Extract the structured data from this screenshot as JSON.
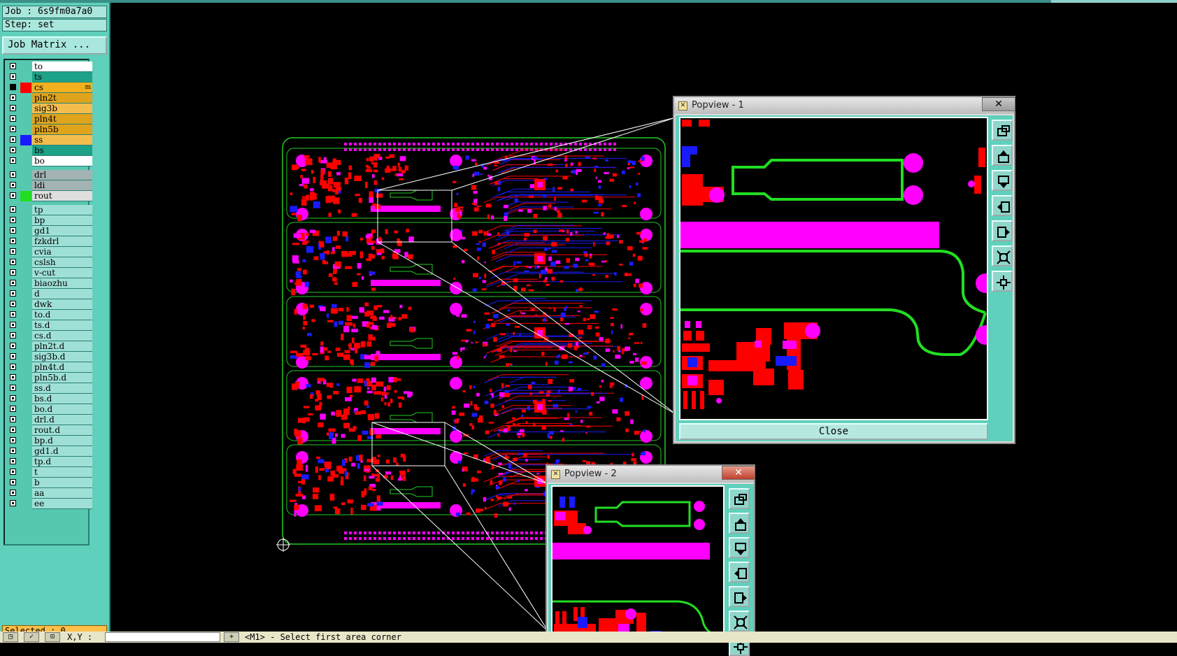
{
  "header": {
    "job_label": "Job : 6s9fm0a7a0",
    "step_label": "Step: set",
    "job_matrix_button": "Job Matrix ..."
  },
  "layers": {
    "board": [
      {
        "name": "to",
        "color": "#ffffff",
        "swatch": ""
      },
      {
        "name": "ts",
        "color": "#1ea287",
        "swatch": ""
      },
      {
        "name": "cs",
        "color": "#f2b01e",
        "swatch": "#ff0000",
        "mark": "m",
        "active": true
      },
      {
        "name": "pln2t",
        "color": "#e0a41c",
        "swatch": ""
      },
      {
        "name": "sig3b",
        "color": "#f3bd4e",
        "swatch": ""
      },
      {
        "name": "pln4t",
        "color": "#e0a41c",
        "swatch": ""
      },
      {
        "name": "pln5b",
        "color": "#e0a41c",
        "swatch": ""
      },
      {
        "name": "ss",
        "color": "#f3bd4e",
        "swatch": "#1a1aff"
      },
      {
        "name": "bs",
        "color": "#1ea287",
        "swatch": ""
      },
      {
        "name": "bo",
        "color": "#ffffff",
        "swatch": ""
      }
    ],
    "drill": [
      {
        "name": "drl",
        "color": "#a3b3b3",
        "swatch": ""
      },
      {
        "name": "ldi",
        "color": "#a3b3b3",
        "swatch": ""
      },
      {
        "name": "rout",
        "color": "#dedede",
        "swatch": "#22dd22"
      }
    ],
    "misc": [
      "tp",
      "bp",
      "gd1",
      "fzkdrl",
      "cvia",
      "cslsh",
      "v-cut",
      "biaozhu",
      "d",
      "dwk",
      "to.d",
      "ts.d",
      "cs.d",
      "pln2t.d",
      "sig3b.d",
      "pln4t.d",
      "pln5b.d",
      "ss.d",
      "bs.d",
      "bo.d",
      "drl.d",
      "rout.d",
      "bp.d",
      "gd1.d",
      "tp.d",
      "t",
      "b",
      "aa",
      "ee"
    ],
    "misc_color": "#9fe0d6"
  },
  "selected_label": "Selected : 0",
  "status": {
    "xy_label": "X,Y :",
    "prompt": "<M1> - Select first area corner"
  },
  "popview1": {
    "title": "Popview - 1",
    "close_label": "Close",
    "close_x": "✕"
  },
  "popview2": {
    "title": "Popview - 2",
    "close_x": "✕"
  },
  "tools": [
    "zoom-fit-icon",
    "pan-up-icon",
    "pan-down-icon",
    "pan-left-icon",
    "pan-right-icon",
    "zoom-in-icon",
    "zoom-out-icon"
  ],
  "colors": {
    "copper": "#ff0000",
    "pad": "#ff00ff",
    "via": "#1a1aff",
    "outline": "#22cc22",
    "panel": "#5fd0bb"
  }
}
